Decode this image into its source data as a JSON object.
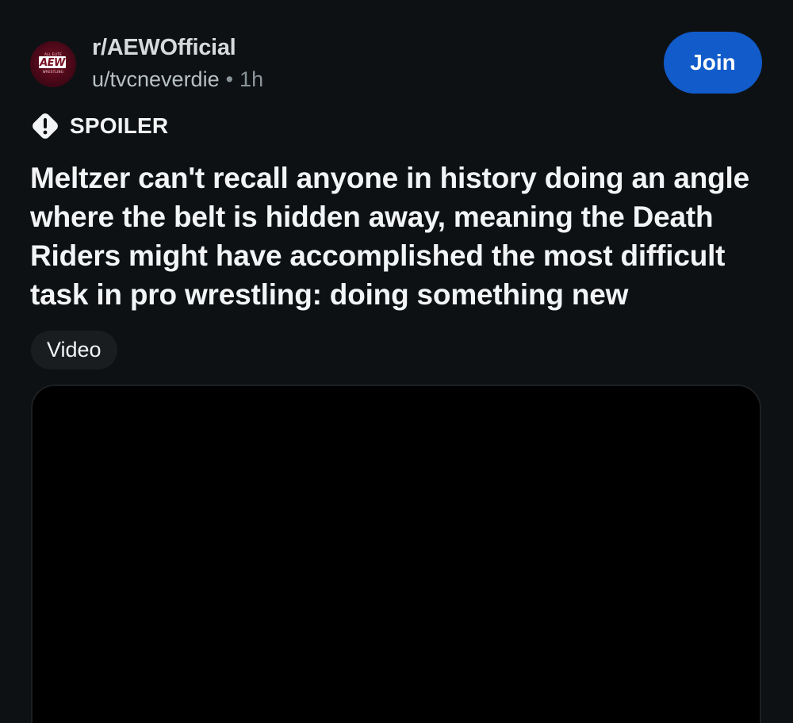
{
  "header": {
    "subreddit": "r/AEWOfficial",
    "author": "u/tvcneverdie",
    "separator": "•",
    "time": "1h",
    "join_label": "Join",
    "avatar": {
      "logo_text": "AEW",
      "top_text": "ALL ELITE",
      "bottom_text": "WRESTLING"
    }
  },
  "post": {
    "spoiler_label": "SPOILER",
    "spoiler_icon": "warning-diamond-icon",
    "title": "Meltzer can't recall anyone in history doing an angle where the belt is hidden away, meaning the Death Riders might have accomplished the most difficult task in pro wrestling: doing something new",
    "flair": "Video"
  },
  "colors": {
    "background": "#0e1113",
    "join_button": "#115bca",
    "flair_background": "#1a1d1f",
    "video_background": "#000000"
  }
}
